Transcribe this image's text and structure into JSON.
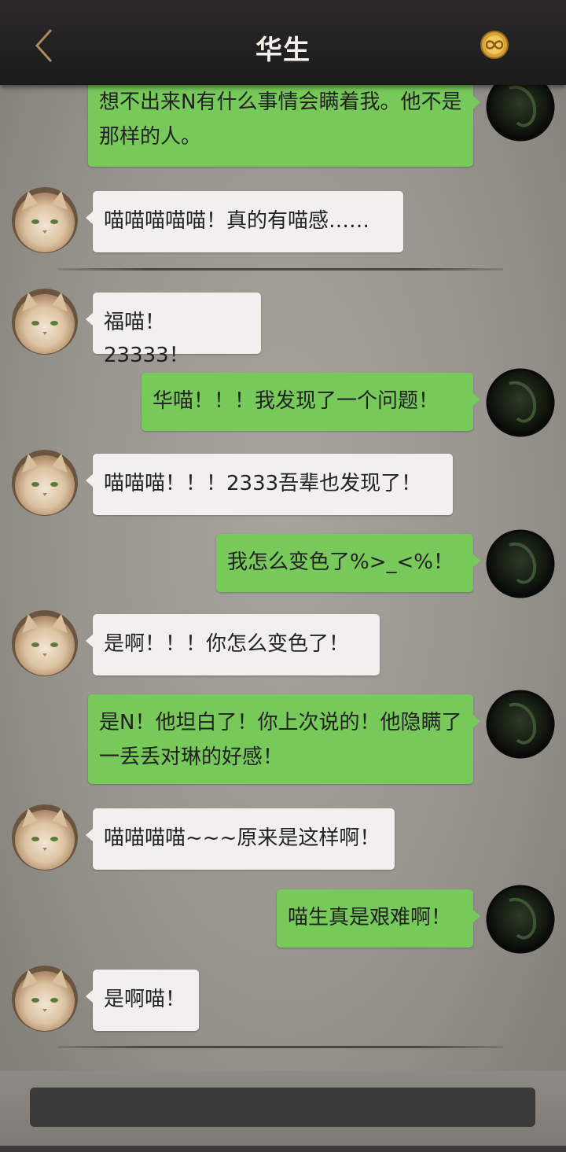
{
  "header": {
    "title": "华生",
    "back_icon": "chevron-left-icon",
    "coin_icon": "infinity-coin-icon"
  },
  "messages": [
    {
      "side": "out",
      "text": "想不出来N有什么事情会瞒着我。他不是那样的人。"
    },
    {
      "side": "in",
      "text": "喵喵喵喵喵！真的有喵感……"
    },
    {
      "side": "in",
      "text": "福喵！23333！"
    },
    {
      "side": "out",
      "text": "华喵！！！我发现了一个问题！"
    },
    {
      "side": "in",
      "text": "喵喵喵！！！2333吾辈也发现了！"
    },
    {
      "side": "out",
      "text": "我怎么变色了%>_<%！"
    },
    {
      "side": "in",
      "text": "是啊！！！你怎么变色了！"
    },
    {
      "side": "out",
      "text": "是N！他坦白了！你上次说的！他隐瞒了一丢丢对琳的好感！"
    },
    {
      "side": "in",
      "text": "喵喵喵喵~~~原来是这样啊！"
    },
    {
      "side": "out",
      "text": "喵生真是艰难啊！"
    },
    {
      "side": "in",
      "text": "是啊喵！"
    }
  ],
  "input": {
    "placeholder": ""
  },
  "colors": {
    "outgoing_bubble": "#77c95a",
    "incoming_bubble": "#f1f0ee",
    "header": "#1f1e1e"
  }
}
